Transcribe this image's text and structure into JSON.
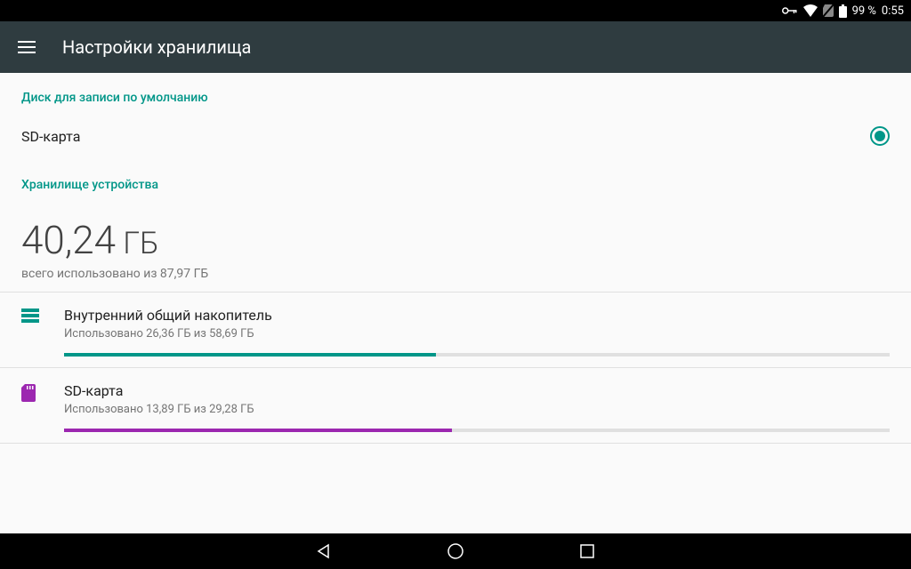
{
  "status": {
    "battery_pct": "99 %",
    "time": "0:55"
  },
  "appbar": {
    "title": "Настройки хранилища"
  },
  "sections": {
    "default_disk": "Диск для записи по умолчанию",
    "device_storage": "Хранилище устройства"
  },
  "radio": {
    "sd_card": "SD-карта"
  },
  "summary": {
    "value": "40,24",
    "unit": "ГБ",
    "sub": "всего использовано из 87,97 ГБ"
  },
  "storage": {
    "internal": {
      "name": "Внутренний общий накопитель",
      "usage": "Использовано 26,36 ГБ из 58,69 ГБ",
      "pct": 45,
      "color": "teal"
    },
    "sd": {
      "name": "SD-карта",
      "usage": "Использовано 13,89 ГБ из 29,28 ГБ",
      "pct": 47,
      "color": "purple"
    }
  }
}
